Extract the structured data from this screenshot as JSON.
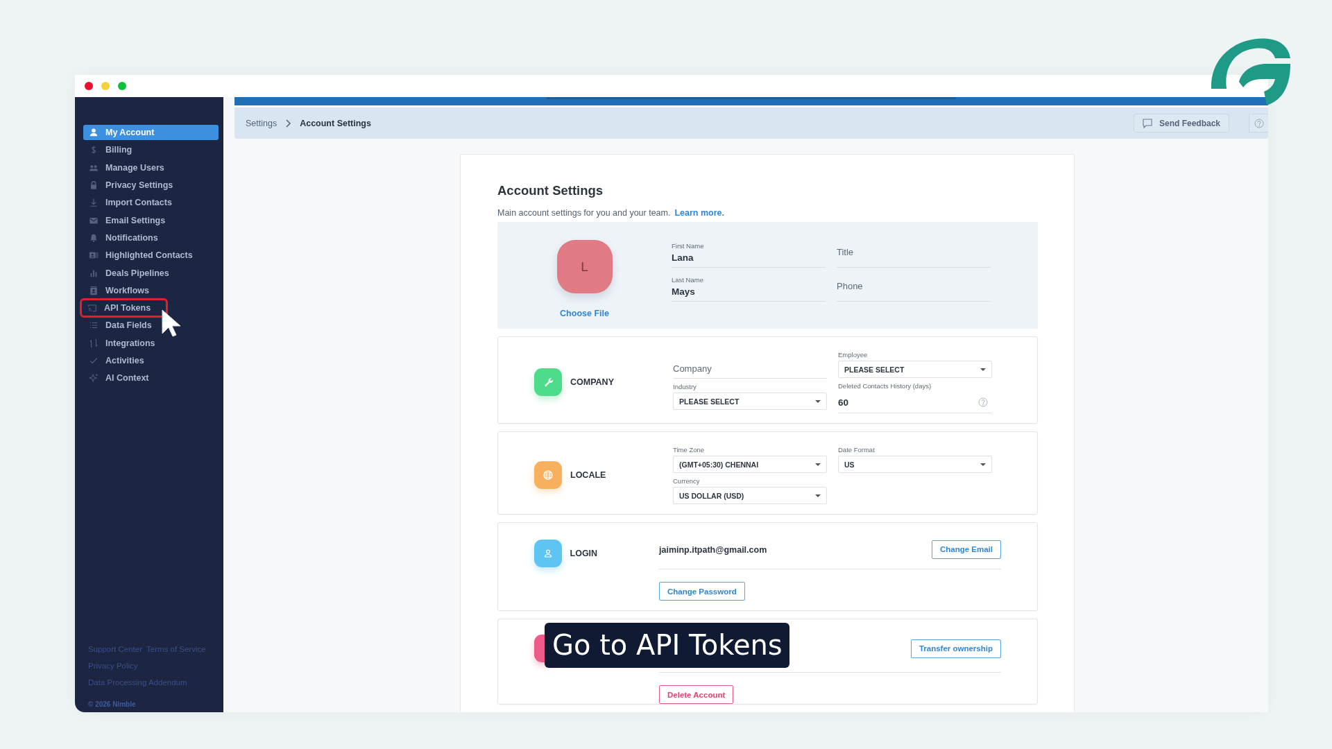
{
  "sidebar": {
    "items": [
      {
        "label": "My Account",
        "selected": true,
        "annotated": false
      },
      {
        "label": "Billing",
        "selected": false,
        "annotated": false
      },
      {
        "label": "Manage Users",
        "selected": false,
        "annotated": false
      },
      {
        "label": "Privacy Settings",
        "selected": false,
        "annotated": false
      },
      {
        "label": "Import Contacts",
        "selected": false,
        "annotated": false
      },
      {
        "label": "Email Settings",
        "selected": false,
        "annotated": false
      },
      {
        "label": "Notifications",
        "selected": false,
        "annotated": false
      },
      {
        "label": "Highlighted Contacts",
        "selected": false,
        "annotated": false
      },
      {
        "label": "Deals Pipelines",
        "selected": false,
        "annotated": false
      },
      {
        "label": "Workflows",
        "selected": false,
        "annotated": false
      },
      {
        "label": "API Tokens",
        "selected": false,
        "annotated": true
      },
      {
        "label": "Data Fields",
        "selected": false,
        "annotated": false
      },
      {
        "label": "Integrations",
        "selected": false,
        "annotated": false
      },
      {
        "label": "Activities",
        "selected": false,
        "annotated": false
      },
      {
        "label": "AI Context",
        "selected": false,
        "annotated": false
      }
    ],
    "footer_links": [
      [
        "Support Center",
        "Terms of Service"
      ],
      [
        "Privacy Policy"
      ],
      [
        "Data Processing Addendum"
      ]
    ],
    "copyright": "© 2026 Nimble"
  },
  "breadcrumb": [
    "Settings",
    "Account Settings"
  ],
  "feedback_button": "Send Feedback",
  "page": {
    "title": "Account Settings",
    "description": "Main account settings for you and your team.",
    "link": "Learn more."
  },
  "profile": {
    "avatar_initial": "L",
    "choose_file": "Choose File",
    "fields": [
      {
        "label": "First Name",
        "value": "Lana"
      },
      {
        "placeholder": "Title"
      },
      {
        "label": "Last Name",
        "value": "Mays"
      },
      {
        "placeholder": "Phone"
      }
    ]
  },
  "sections": [
    {
      "kind": "fields",
      "title": "COMPANY",
      "color": "#4fdc8a",
      "columns": [
        [
          {
            "kind": "text",
            "placeholder": "Company",
            "help": false
          },
          {
            "kind": "select",
            "label": "Industry",
            "value": "PLEASE SELECT"
          }
        ],
        [
          {
            "kind": "select",
            "label": "Employee",
            "value": "PLEASE SELECT"
          },
          {
            "kind": "text",
            "label": "Deleted Contacts History (days)",
            "value": "60",
            "help": true
          }
        ]
      ]
    },
    {
      "kind": "fields",
      "title": "LOCALE",
      "color": "#f7b15e",
      "columns": [
        [
          {
            "kind": "select",
            "label": "Time Zone",
            "value": "(GMT+05:30) CHENNAI"
          },
          {
            "kind": "select",
            "label": "Currency",
            "value": "US DOLLAR (USD)"
          }
        ],
        [
          {
            "kind": "select",
            "label": "Date Format",
            "value": "US"
          }
        ]
      ]
    },
    {
      "kind": "login",
      "title": "LOGIN",
      "color": "#5ec4f2",
      "email": "jaiminp.itpath@gmail.com",
      "buttons": [
        "Change Email",
        "Change Password"
      ]
    },
    {
      "kind": "ownership",
      "color": "#ee5a8a",
      "buttons": [
        "Transfer ownership",
        "Delete Account"
      ]
    }
  ],
  "caption": "Go to API Tokens"
}
